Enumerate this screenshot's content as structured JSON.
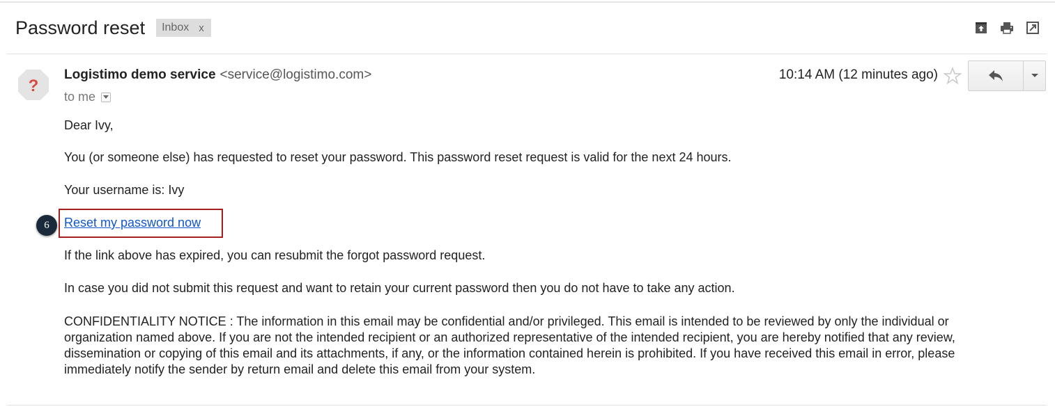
{
  "thread": {
    "subject": "Password reset",
    "label": "Inbox",
    "label_remove": "x"
  },
  "header_icons": [
    "archive-icon",
    "print-icon",
    "new-window-icon"
  ],
  "message": {
    "sender_name": "Logistimo demo service",
    "sender_email": "<service@logistimo.com>",
    "to": "to me",
    "timestamp": "10:14 AM (12 minutes ago)",
    "greeting": "Dear Ivy,",
    "para1": "You (or someone else) has requested to reset your password. This password reset request is valid for the next 24 hours.",
    "username_line": "Your username is: Ivy",
    "reset_link": "Reset my password now",
    "para2": "If the link above has expired, you can resubmit the forgot password request.",
    "para3": "In case you did not submit this request and want to retain your current password then you do not have to take any action.",
    "confidentiality": "CONFIDENTIALITY NOTICE : The information in this email may be confidential and/or privileged. This email is intended to be reviewed by only the individual or organization named above. If you are not the intended recipient or an authorized representative of the intended recipient, you are hereby notified that any review, dissemination or copying of this email and its attachments, if any, or the information contained herein is prohibited. If you have received this email in error, please immediately notify the sender by return email and delete this email from your system."
  },
  "annotation": {
    "step_number": "6"
  },
  "colors": {
    "link": "#1155cc",
    "highlight_border": "#a51d1d",
    "badge": "#1a2a3a"
  }
}
